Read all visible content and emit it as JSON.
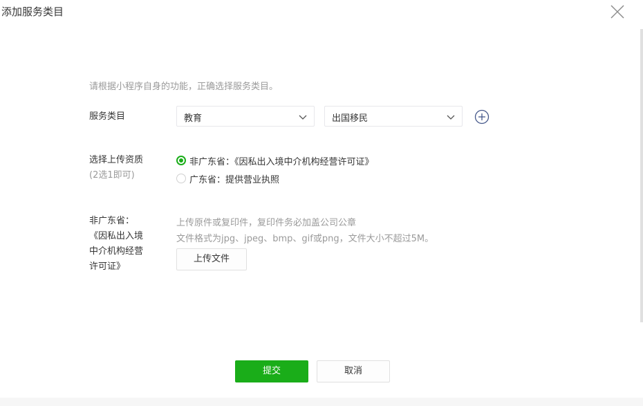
{
  "dialog": {
    "title": "添加服务类目",
    "close_icon": "close-icon"
  },
  "hint": "请根据小程序自身的功能，正确选择服务类目。",
  "service_category": {
    "label": "服务类目",
    "primary_value": "教育",
    "secondary_value": "出国移民",
    "add_icon": "plus-circle-icon"
  },
  "qualification": {
    "label": "选择上传资质",
    "sublabel": "(2选1即可)",
    "options": [
      {
        "label": "非广东省：《因私出入境中介机构经营许可证》",
        "checked": true
      },
      {
        "label": "广东省：提供营业执照",
        "checked": false
      }
    ]
  },
  "upload": {
    "label_lines": [
      "非广东省：",
      "《因私出入境",
      "中介机构经营",
      "许可证》"
    ],
    "desc1": "上传原件或复印件，复印件务必加盖公司公章",
    "desc2": "文件格式为jpg、jpeg、bmp、gif或png，文件大小不超过5M。",
    "button_label": "上传文件"
  },
  "footer": {
    "submit_label": "提交",
    "cancel_label": "取消"
  },
  "colors": {
    "accent": "#1aad19",
    "text": "#353535",
    "muted": "#9a9a9a",
    "border": "#e7e7eb"
  }
}
